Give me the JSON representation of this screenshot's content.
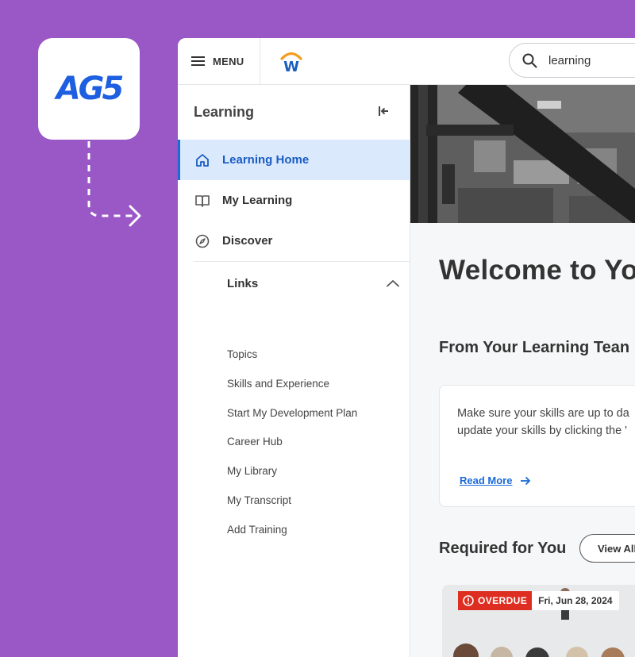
{
  "brand": {
    "badge_text": "AG5",
    "badge_color": "#1d5fe0",
    "background_color": "#9a57c6"
  },
  "topbar": {
    "menu_label": "MENU",
    "menu_icon": "hamburger-icon",
    "logo_letter": "W",
    "search_icon": "search-icon",
    "search_value": "learning"
  },
  "sidebar": {
    "title": "Learning",
    "collapse_icon": "collapse-left-icon",
    "items": [
      {
        "label": "Learning Home",
        "icon": "home-icon",
        "active": true
      },
      {
        "label": "My Learning",
        "icon": "book-icon",
        "active": false
      },
      {
        "label": "Discover",
        "icon": "compass-icon",
        "active": false
      }
    ],
    "links_label": "Links",
    "links_chevron": "chevron-up-icon",
    "links": [
      "Topics",
      "Skills and Experience",
      "Start My Development Plan",
      "Career Hub",
      "My Library",
      "My Transcript",
      "Add Training"
    ]
  },
  "main": {
    "welcome": "Welcome to Yo",
    "from_team_title": "From Your Learning Tean",
    "card": {
      "line1": "Make sure your skills are up to da",
      "line2": "update your skills by clicking the '",
      "read_more": "Read More"
    },
    "required_title": "Required for You",
    "view_all": "View All",
    "course": {
      "status": "OVERDUE",
      "due_date": "Fri, Jun 28, 2024"
    }
  },
  "colors": {
    "accent": "#1a6ad8",
    "active_bg": "#dbe9fd",
    "overdue": "#de2e21"
  }
}
